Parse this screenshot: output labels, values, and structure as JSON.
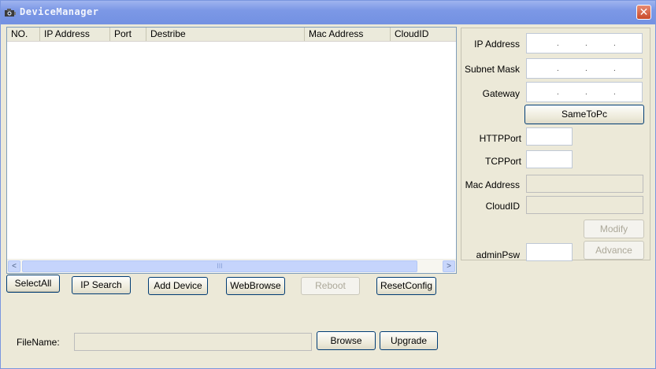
{
  "window": {
    "title": "DeviceManager",
    "close_glyph": "✕",
    "icon": "camera-icon"
  },
  "device_list": {
    "columns": [
      "NO.",
      "IP Address",
      "Port",
      "Destribe",
      "Mac Address",
      "CloudID"
    ],
    "rows": [],
    "scroll_left_glyph": "<",
    "scroll_right_glyph": ">",
    "scroll_thumb_grip": "III"
  },
  "config_panel": {
    "ip_address_label": "IP Address",
    "subnet_mask_label": "Subnet Mask",
    "gateway_label": "Gateway",
    "ip_dots": [
      ".",
      ".",
      "."
    ],
    "same_to_pc_label": "SameToPc",
    "http_port_label": "HTTPPort",
    "http_port_value": "",
    "tcp_port_label": "TCPPort",
    "tcp_port_value": "",
    "mac_address_label": "Mac Address",
    "mac_address_value": "",
    "cloud_id_label": "CloudID",
    "cloud_id_value": "",
    "modify_label": "Modify",
    "advance_label": "Advance",
    "admin_psw_label": "adminPsw",
    "admin_psw_value": ""
  },
  "toolbar": {
    "select_all_label": "SelectAll",
    "ip_search_label": "IP Search",
    "add_device_label": "Add Device",
    "web_browse_label": "WebBrowse",
    "reboot_label": "Reboot",
    "reset_config_label": "ResetConfig"
  },
  "upgrade": {
    "file_name_label": "FileName:",
    "file_name_value": "",
    "browse_label": "Browse",
    "upgrade_label": "Upgrade"
  },
  "colors": {
    "titlebar": "#7f9be9",
    "window_bg": "#ece9d8",
    "disabled_text": "#aca899"
  }
}
